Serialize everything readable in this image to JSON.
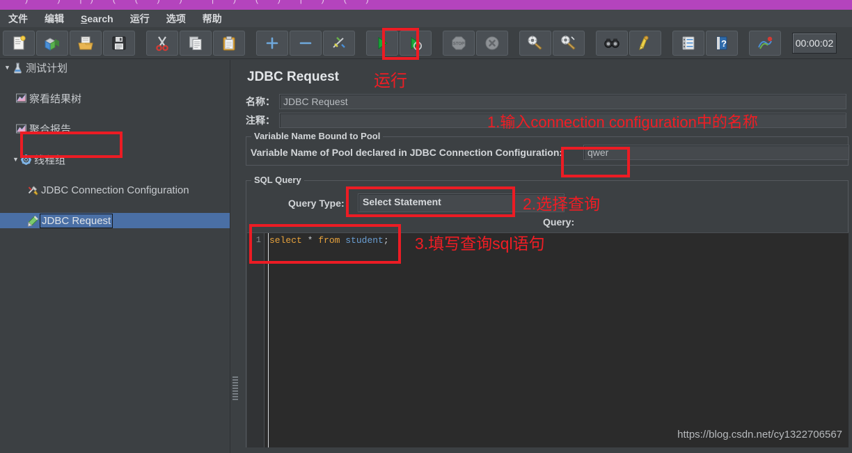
{
  "window": {
    "title_bar_text": "· ) ') |) ( ( ) ) '| ) ( ) | ) ( )"
  },
  "menubar": {
    "items": [
      {
        "label": "文件",
        "mnemonic": ""
      },
      {
        "label": "编辑",
        "mnemonic": ""
      },
      {
        "label": "Search",
        "mnemonic": "S"
      },
      {
        "label": "运行",
        "mnemonic": ""
      },
      {
        "label": "选项",
        "mnemonic": ""
      },
      {
        "label": "帮助",
        "mnemonic": ""
      }
    ]
  },
  "toolbar": {
    "buttons": [
      {
        "name": "new-icon",
        "title": "新建"
      },
      {
        "name": "templates-icon",
        "title": "模板"
      },
      {
        "name": "open-icon",
        "title": "打开"
      },
      {
        "name": "save-icon",
        "title": "保存"
      },
      {
        "name": "cut-icon",
        "title": "剪切"
      },
      {
        "name": "copy-icon",
        "title": "复制"
      },
      {
        "name": "paste-icon",
        "title": "粘贴"
      },
      {
        "name": "expand-icon",
        "title": "展开"
      },
      {
        "name": "collapse-icon",
        "title": "折叠"
      },
      {
        "name": "toggle-icon",
        "title": "启用/禁用"
      },
      {
        "name": "start-icon",
        "title": "启动"
      },
      {
        "name": "start-no-pauses-icon",
        "title": "无停顿启动"
      },
      {
        "name": "stop-icon",
        "title": "停止"
      },
      {
        "name": "shutdown-icon",
        "title": "关闭"
      },
      {
        "name": "clear-icon",
        "title": "清除"
      },
      {
        "name": "clear-all-icon",
        "title": "清除全部"
      },
      {
        "name": "search-icon",
        "title": "查找"
      },
      {
        "name": "search-reset-icon",
        "title": "重置查找"
      },
      {
        "name": "function-helper-icon",
        "title": "函数助手"
      },
      {
        "name": "help-icon",
        "title": "帮助"
      },
      {
        "name": "threads-icon",
        "title": "线程数"
      }
    ],
    "timer_value": "00:00:02"
  },
  "tree": {
    "nodes": [
      {
        "label": "测试计划",
        "icon": "test-plan-icon",
        "depth": 0,
        "twisty": "▼",
        "selected": false
      },
      {
        "label": "察看结果树",
        "icon": "view-results-tree-icon",
        "depth": 1,
        "twisty": "",
        "selected": false
      },
      {
        "label": "聚合报告",
        "icon": "aggregate-report-icon",
        "depth": 1,
        "twisty": "",
        "selected": false
      },
      {
        "label": "线程组",
        "icon": "thread-group-icon",
        "depth": 1,
        "twisty": "▼",
        "selected": false
      },
      {
        "label": "JDBC Connection Configuration",
        "icon": "jdbc-connection-config-icon",
        "depth": 2,
        "twisty": "",
        "selected": false
      },
      {
        "label": "JDBC Request",
        "icon": "jdbc-request-icon",
        "depth": 2,
        "twisty": "",
        "selected": true
      }
    ]
  },
  "main": {
    "panel_title": "JDBC Request",
    "name_label": "名称：",
    "name_value": "JDBC Request",
    "comment_label": "注释：",
    "comment_value": "",
    "pool_group_title": "Variable Name Bound to Pool",
    "pool_field_label": "Variable Name of Pool declared in JDBC Connection Configuration:",
    "pool_field_value": "qwer",
    "sql_group_title": "SQL Query",
    "query_type_label": "Query Type:",
    "query_type_value": "Select Statement",
    "query_label": "Query:",
    "sql_line_number": "1",
    "sql_tokens": [
      {
        "text": "select",
        "kind": "keyword"
      },
      {
        "text": " * ",
        "kind": "punct"
      },
      {
        "text": "from",
        "kind": "keyword"
      },
      {
        "text": " ",
        "kind": "punct"
      },
      {
        "text": "student",
        "kind": "identifier"
      },
      {
        "text": ";",
        "kind": "punct"
      }
    ],
    "sql_text": "select * from student;"
  },
  "annotations": [
    {
      "name": "annotation-run",
      "text": "运行",
      "size": 22
    },
    {
      "name": "annotation-step-1",
      "text": "1.输入connection configuration中的名称",
      "size": 22
    },
    {
      "name": "annotation-step-2",
      "text": "2.选择查询",
      "size": 22
    },
    {
      "name": "annotation-step-3",
      "text": "3.填写查询sql语句",
      "size": 22
    }
  ],
  "watermark": {
    "text": "https://blog.csdn.net/cy1322706567"
  },
  "colors": {
    "accent_red": "#ec1c24",
    "selection_blue": "#4a6fa5",
    "title_purple": "#b444bd",
    "panel_bg": "#3c4043",
    "editor_bg": "#2b2b2b",
    "keyword": "#e8a33d",
    "identifier": "#6a9fd4"
  }
}
